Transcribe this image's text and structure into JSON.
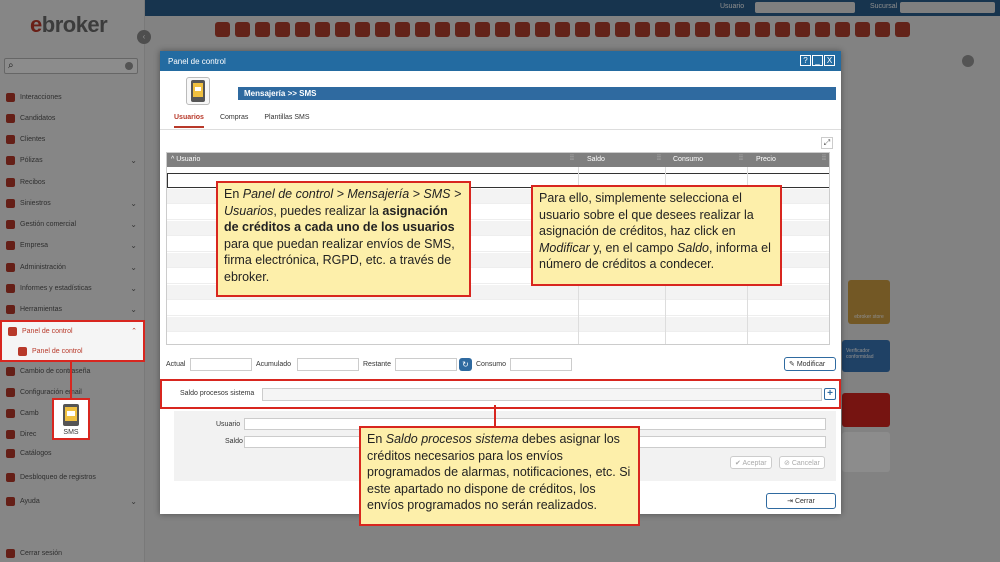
{
  "app": {
    "logo": "ebroker",
    "topbar": {
      "user_label": "Usuario",
      "branch_label": "Sucursal"
    },
    "search_placeholder": "",
    "sidebar_items": [
      "Interacciones",
      "Candidatos",
      "Clientes",
      "Pólizas",
      "Recibos",
      "Siniestros",
      "Gestión comercial",
      "Empresa",
      "Administración",
      "Informes y estadísticas",
      "Herramientas",
      "Panel de control",
      "Panel de control",
      "Cambio de contraseña",
      "Configuración email",
      "Camb",
      "Direc",
      "Catálogos",
      "Desbloqueo de registros",
      "Ayuda",
      "Cerrar sesión"
    ],
    "sms_icon_label": "SMS",
    "bg_tile_label": "ebroker store",
    "bg_tile2_label": "Verificador conformidad"
  },
  "dialog": {
    "title": "Panel de control",
    "help": "?",
    "minimize": "_",
    "close": "X",
    "module_title": "Mensajería >> SMS",
    "tabs": [
      "Usuarios",
      "Compras",
      "Plantillas SMS"
    ],
    "grid": {
      "columns": [
        "Usuario",
        "Saldo",
        "Consumo",
        "Precio"
      ]
    },
    "totals": {
      "actual": "Actual",
      "acumulado": "Acumulado",
      "restante": "Restante",
      "consumo": "Consumo"
    },
    "modify_button": "Modificar",
    "saldo_procesos_label": "Saldo procesos sistema",
    "plus_button": "+",
    "user_label": "Usuario",
    "saldo_label": "Saldo",
    "accept_button": "Aceptar",
    "cancel_button": "Cancelar",
    "close_button": "Cerrar"
  },
  "callouts": {
    "one": {
      "p1": "En ",
      "e1": "Panel de control > Mensajería > SMS > Usuarios",
      "p2": ", puedes realizar la ",
      "b1": "asignación de créditos a cada uno de los usuarios",
      "p3": " para que puedan realizar envíos de SMS, firma electrónica, RGPD, etc. a través de ebroker."
    },
    "two": {
      "p1": "Para ello, simplemente selecciona el usuario sobre el que desees realizar la asignación de créditos, haz click en ",
      "e1": "Modificar",
      "p2": " y, en el campo ",
      "e2": "Saldo",
      "p3": ", informa el número de créditos a condecer."
    },
    "three": {
      "p1": "En ",
      "e1": "Saldo procesos sistema",
      "p2": " debes asignar los créditos necesarios para los envíos programados de alarmas, notificaciones, etc. Si este apartado no dispone de créditos, los envíos programados no serán realizados."
    }
  }
}
